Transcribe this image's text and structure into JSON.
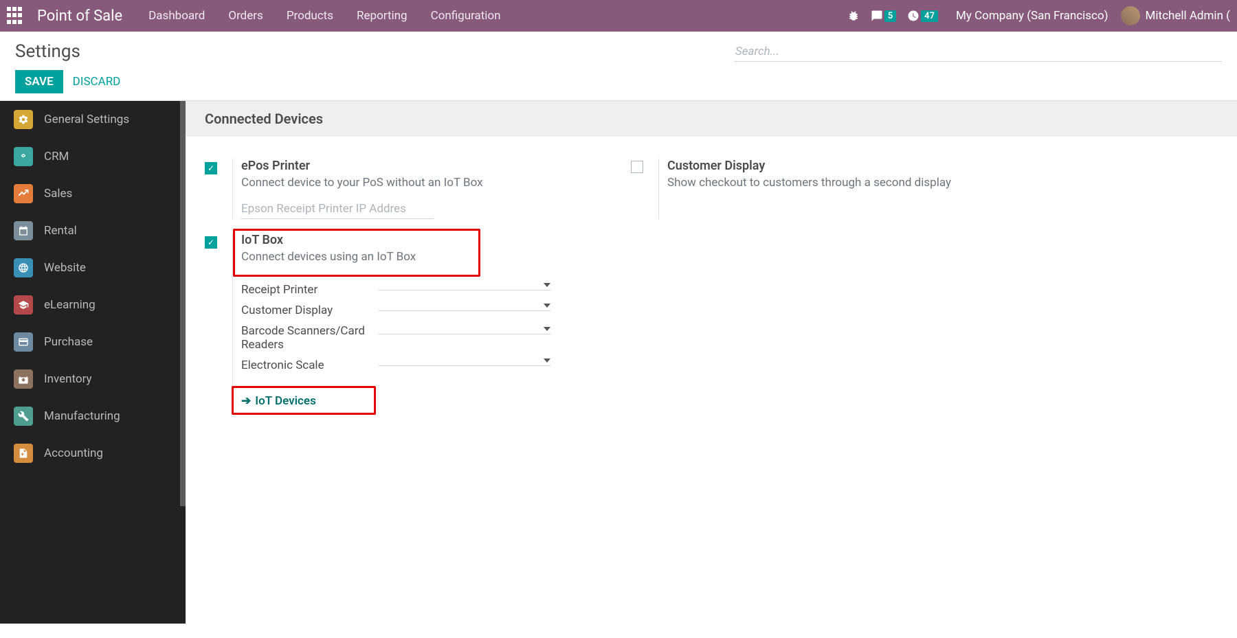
{
  "navbar": {
    "brand": "Point of Sale",
    "items": [
      "Dashboard",
      "Orders",
      "Products",
      "Reporting",
      "Configuration"
    ],
    "messages_count": "5",
    "activities_count": "47",
    "company": "My Company (San Francisco)",
    "user": "Mitchell Admin ("
  },
  "control_panel": {
    "title": "Settings",
    "save": "SAVE",
    "discard": "DISCARD",
    "search_placeholder": "Search..."
  },
  "sidebar": {
    "items": [
      {
        "label": "General Settings"
      },
      {
        "label": "CRM"
      },
      {
        "label": "Sales"
      },
      {
        "label": "Rental"
      },
      {
        "label": "Website"
      },
      {
        "label": "eLearning"
      },
      {
        "label": "Purchase"
      },
      {
        "label": "Inventory"
      },
      {
        "label": "Manufacturing"
      },
      {
        "label": "Accounting"
      }
    ]
  },
  "section": {
    "title": "Connected Devices"
  },
  "settings": {
    "epos": {
      "title": "ePos Printer",
      "desc": "Connect device to your PoS without an IoT Box",
      "placeholder": "Epson Receipt Printer IP Addres"
    },
    "customer_display": {
      "title": "Customer Display",
      "desc": "Show checkout to customers through a second display"
    },
    "iotbox": {
      "title": "IoT Box",
      "desc": "Connect devices using an IoT Box",
      "fields": {
        "receipt_printer": "Receipt Printer",
        "customer_display": "Customer Display",
        "barcode": "Barcode Scanners/Card Readers",
        "electronic_scale": "Electronic Scale"
      },
      "link": "IoT Devices"
    }
  }
}
